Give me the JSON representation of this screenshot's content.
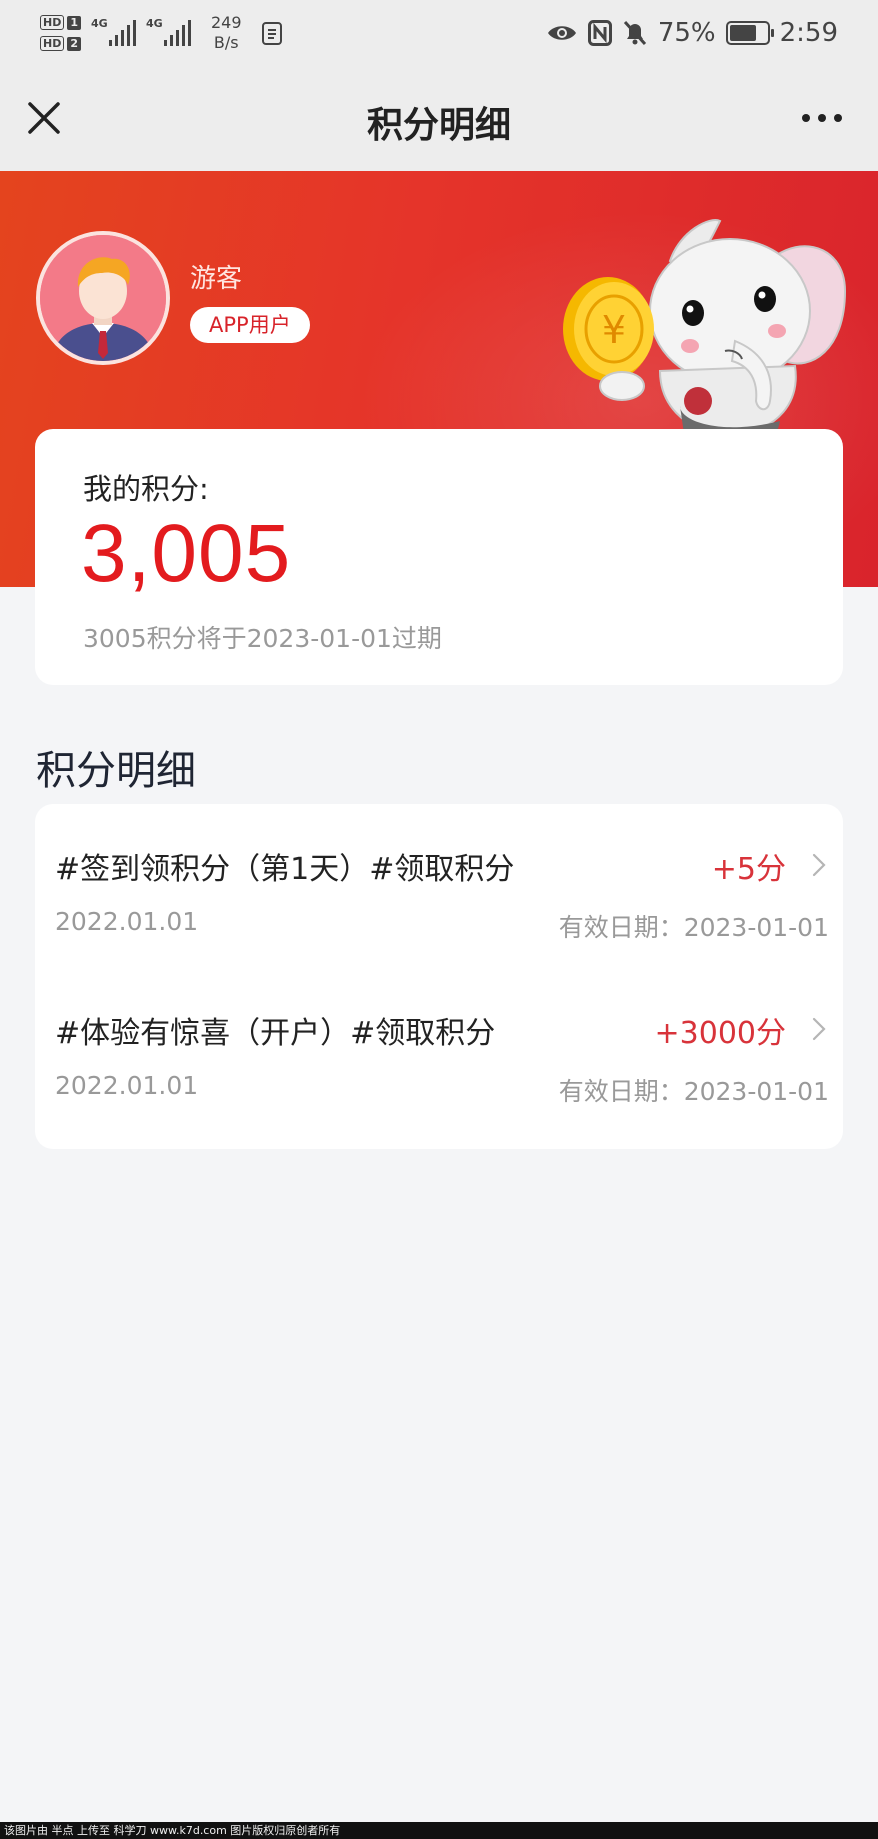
{
  "status_bar": {
    "sim1": "HD",
    "sim1_index": "1",
    "sim2": "HD",
    "sim2_index": "2",
    "network1": "4G",
    "network2": "4G",
    "speed_value": "249",
    "speed_unit": "B/s",
    "battery_percent": "75%",
    "battery_level": 0.75,
    "time": "2:59",
    "icons": [
      "eye-icon",
      "nfc-icon",
      "bell-muted-icon",
      "battery-icon"
    ]
  },
  "nav": {
    "title": "积分明细",
    "close_icon": "close-icon",
    "more_icon": "more-icon"
  },
  "user": {
    "name": "游客",
    "badge": "APP用户"
  },
  "points": {
    "label": "我的积分:",
    "value": "3,005",
    "expire_text": "3005积分将于2023-01-01过期"
  },
  "details": {
    "title": "积分明细",
    "items": [
      {
        "title": "#签到领积分（第1天）#领取积分",
        "points": "+5分",
        "date": "2022.01.01",
        "valid": "有效日期：2023-01-01"
      },
      {
        "title": "#体验有惊喜（开户）#领取积分",
        "points": "+3000分",
        "date": "2022.01.01",
        "valid": "有效日期：2023-01-01"
      }
    ]
  },
  "watermark": "该图片由 半点 上传至 科学刀 www.k7d.com 图片版权归原创者所有",
  "colors": {
    "accent_red": "#e31b1e",
    "header_red": "#e5342a",
    "points_red": "#d8333a"
  }
}
